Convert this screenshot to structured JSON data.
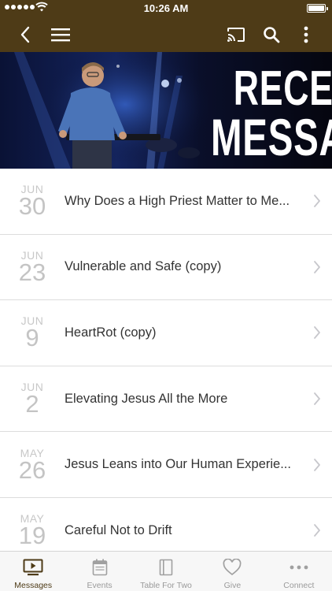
{
  "status_bar": {
    "time": "10:26 AM"
  },
  "nav": {
    "back_icon": "chevron-left-icon",
    "menu_icon": "hamburger-menu-icon",
    "cast_icon": "cast-icon",
    "search_icon": "search-icon",
    "more_icon": "more-vertical-icon"
  },
  "hero": {
    "line1": "RECENT",
    "line2": "MESSAGES"
  },
  "messages": [
    {
      "month": "JUN",
      "day": "30",
      "title": "Why Does a High Priest Matter to Me..."
    },
    {
      "month": "JUN",
      "day": "23",
      "title": "Vulnerable and Safe (copy)"
    },
    {
      "month": "JUN",
      "day": "9",
      "title": "HeartRot (copy)"
    },
    {
      "month": "JUN",
      "day": "2",
      "title": "Elevating Jesus All the More"
    },
    {
      "month": "MAY",
      "day": "26",
      "title": "Jesus Leans into Our Human Experie..."
    },
    {
      "month": "MAY",
      "day": "19",
      "title": "Careful Not to Drift"
    }
  ],
  "tabs": [
    {
      "label": "Messages",
      "icon": "tv-play-icon",
      "active": true
    },
    {
      "label": "Events",
      "icon": "calendar-icon",
      "active": false
    },
    {
      "label": "Table For Two",
      "icon": "book-icon",
      "active": false
    },
    {
      "label": "Give",
      "icon": "heart-icon",
      "active": false
    },
    {
      "label": "Connect",
      "icon": "more-horizontal-icon",
      "active": false
    }
  ],
  "colors": {
    "brand": "#4e3b17",
    "tab_inactive": "#9a9a9a",
    "date_text": "#c4c4c4"
  }
}
